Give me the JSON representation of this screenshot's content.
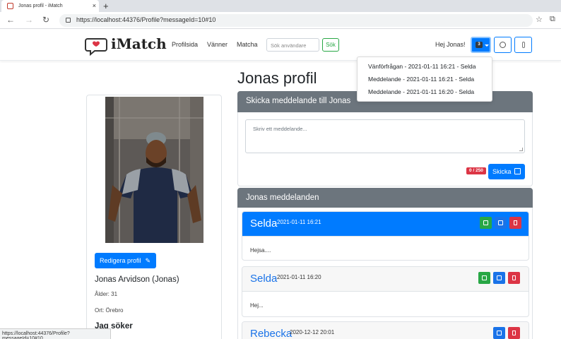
{
  "browser": {
    "tab_title": "Jonas profil - iMatch",
    "url": "https://localhost:44376/Profile?messageId=10#10",
    "status_url": "https://localhost:44376/Profile?messageId=10#10"
  },
  "navbar": {
    "brand": "iMatch",
    "links": [
      "Profilsida",
      "Vänner",
      "Matcha"
    ],
    "search_placeholder": "Sök användare",
    "search_button": "Sök",
    "greeting": "Hej Jonas!",
    "notification_count": "3"
  },
  "notifications": [
    "Vänförfrågan - 2021-01-11 16:21 - Selda",
    "Meddelande - 2021-01-11 16:21 - Selda",
    "Meddelande - 2021-01-11 16:20 - Selda"
  ],
  "page_title": "Jonas profil",
  "profile": {
    "edit_button": "Redigera profil",
    "full_name": "Jonas Arvidson (Jonas)",
    "age": "Ålder: 31",
    "city": "Ort: Örebro",
    "seeking_heading": "Jag söker"
  },
  "send_panel": {
    "heading": "Skicka meddelande till Jonas",
    "placeholder": "Skriv ett meddelande...",
    "counter": "0 / 250",
    "send_button": "Skicka"
  },
  "messages_panel": {
    "heading": "Jonas meddelanden",
    "messages": [
      {
        "sender": "Selda",
        "date": "2021-01-11 16:21",
        "body": "Hejsa...."
      },
      {
        "sender": "Selda",
        "date": "2021-01-11 16:20",
        "body": "Hej..."
      },
      {
        "sender": "Rebecka",
        "date": "2020-12-12 20:01",
        "body": ""
      }
    ]
  },
  "colors": {
    "primary": "#007bff",
    "panel_header": "#6c757d",
    "success": "#28a745",
    "danger": "#dc3545"
  },
  "icons": [
    "tab-favicon-icon",
    "close-icon",
    "new-tab-icon",
    "back-icon",
    "forward-icon",
    "reload-icon",
    "lock-icon",
    "favorites-icon",
    "collections-icon",
    "chat-heart-logo-icon",
    "user-icon",
    "logout-icon",
    "pencil-icon",
    "edit-icon",
    "check-icon",
    "trash-icon"
  ]
}
